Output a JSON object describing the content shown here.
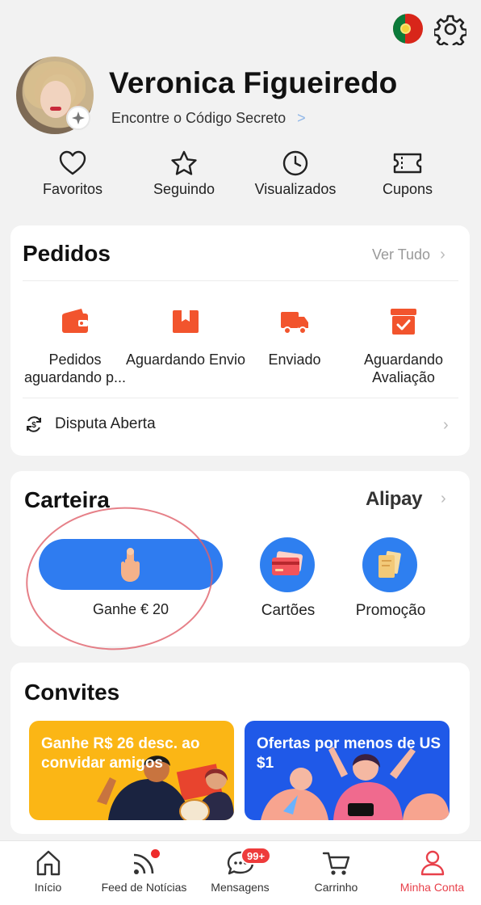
{
  "header": {
    "flag_icon": "portugal-flag-icon",
    "settings_icon": "gear-icon"
  },
  "profile": {
    "name": "Veronica Figueiredo",
    "secret_code_link": "Encontre o Código Secreto",
    "secret_code_chevron": ">"
  },
  "quick_links": [
    {
      "label": "Favoritos",
      "icon": "heart-icon"
    },
    {
      "label": "Seguindo",
      "icon": "star-icon"
    },
    {
      "label": "Visualizados",
      "icon": "clock-icon"
    },
    {
      "label": "Cupons",
      "icon": "ticket-icon"
    }
  ],
  "orders": {
    "title": "Pedidos",
    "see_all": "Ver Tudo",
    "items": [
      {
        "label": "Pedidos aguardando p...",
        "icon": "wallet-icon"
      },
      {
        "label": "Aguardando Envio",
        "icon": "box-icon"
      },
      {
        "label": "Enviado",
        "icon": "truck-icon"
      },
      {
        "label": "Aguardando Avaliação",
        "icon": "review-icon"
      }
    ],
    "dispute": "Disputa Aberta"
  },
  "wallet": {
    "title": "Carteira",
    "brand": "Alipay",
    "earn": "Ganhe € 20",
    "cards": "Cartões",
    "promo": "Promoção"
  },
  "invites": {
    "title": "Convites",
    "banner_left": "Ganhe R$ 26 desc. ao convidar amigos",
    "banner_right": "Ofertas por menos de US $1"
  },
  "nav": {
    "items": [
      {
        "label": "Início",
        "icon": "home-icon"
      },
      {
        "label": "Feed de Notícias",
        "icon": "feed-icon"
      },
      {
        "label": "Mensagens",
        "icon": "message-icon"
      },
      {
        "label": "Carrinho",
        "icon": "cart-icon"
      },
      {
        "label": "Minha Conta",
        "icon": "account-icon"
      }
    ],
    "messages_badge": "99+",
    "active_color": "#e8404a"
  },
  "colors": {
    "accent_orange": "#f2542d",
    "wallet_blue": "#2f7cf0"
  }
}
